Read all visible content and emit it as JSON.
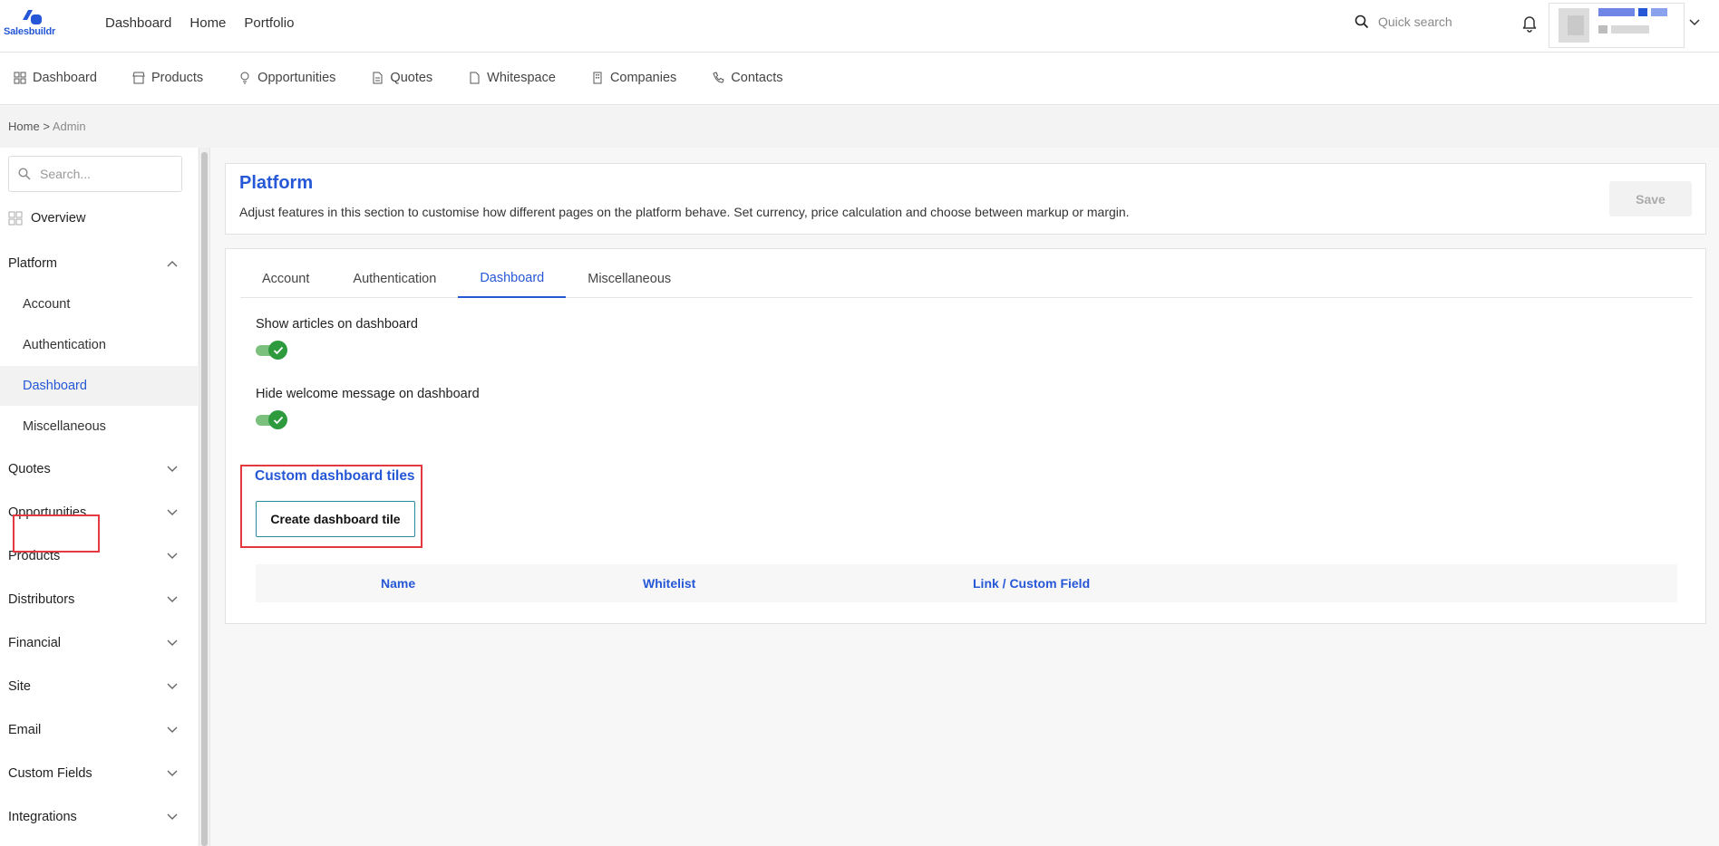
{
  "brand": {
    "name": "Salesbuildr",
    "accent": "#2557d6"
  },
  "topnav": {
    "items": [
      "Dashboard",
      "Home",
      "Portfolio"
    ]
  },
  "search": {
    "placeholder": "Quick search"
  },
  "secondary_nav": {
    "items": [
      {
        "label": "Dashboard",
        "icon": "grid-icon"
      },
      {
        "label": "Products",
        "icon": "store-icon"
      },
      {
        "label": "Opportunities",
        "icon": "lightbulb-icon"
      },
      {
        "label": "Quotes",
        "icon": "document-icon"
      },
      {
        "label": "Whitespace",
        "icon": "file-icon"
      },
      {
        "label": "Companies",
        "icon": "building-icon"
      },
      {
        "label": "Contacts",
        "icon": "phone-icon"
      }
    ]
  },
  "breadcrumb": {
    "home": "Home",
    "separator": ">",
    "current": "Admin"
  },
  "sidebar": {
    "search_placeholder": "Search...",
    "overview": "Overview",
    "platform": {
      "label": "Platform",
      "items": [
        "Account",
        "Authentication",
        "Dashboard",
        "Miscellaneous"
      ],
      "active": "Dashboard"
    },
    "sections": [
      "Quotes",
      "Opportunities",
      "Products",
      "Distributors",
      "Financial",
      "Site",
      "Email",
      "Custom Fields",
      "Integrations"
    ]
  },
  "header": {
    "title": "Platform",
    "description": "Adjust features in this section to customise how different pages on the platform behave. Set currency, price calculation and choose between markup or margin.",
    "save_label": "Save"
  },
  "tabs": {
    "items": [
      "Account",
      "Authentication",
      "Dashboard",
      "Miscellaneous"
    ],
    "active": "Dashboard"
  },
  "settings": {
    "show_articles": {
      "label": "Show articles on dashboard",
      "enabled": true
    },
    "hide_welcome": {
      "label": "Hide welcome message on dashboard",
      "enabled": true
    }
  },
  "tiles": {
    "title": "Custom dashboard tiles",
    "create_label": "Create dashboard tile",
    "columns": [
      "Name",
      "Whitelist",
      "Link / Custom Field"
    ]
  }
}
